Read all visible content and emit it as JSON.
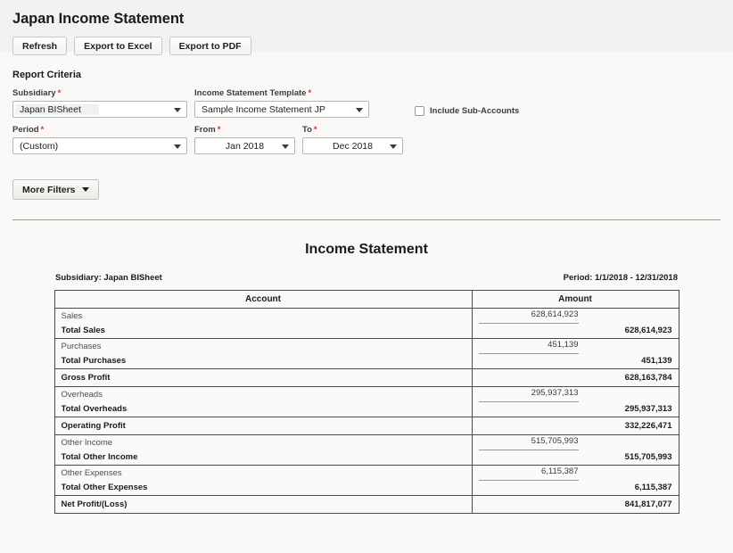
{
  "header": {
    "title": "Japan Income Statement",
    "buttons": [
      {
        "label": "Refresh",
        "name": "refresh-button"
      },
      {
        "label": "Export to Excel",
        "name": "export-excel-button"
      },
      {
        "label": "Export to PDF",
        "name": "export-pdf-button"
      }
    ]
  },
  "criteria": {
    "section_title": "Report Criteria",
    "subsidiary": {
      "label": "Subsidiary",
      "required": "*",
      "value": "Japan BISheet"
    },
    "template": {
      "label": "Income Statement Template",
      "required": "*",
      "value": "Sample Income Statement JP"
    },
    "period": {
      "label": "Period",
      "required": "*",
      "value": "(Custom)"
    },
    "from": {
      "label": "From",
      "required": "*",
      "value": "Jan 2018"
    },
    "to": {
      "label": "To",
      "required": "*",
      "value": "Dec 2018"
    },
    "include_sub_accounts": {
      "label": "Include Sub-Accounts",
      "checked": false
    },
    "more_filters": {
      "label": "More Filters",
      "icon": "chevron-down-icon"
    }
  },
  "report": {
    "title": "Income Statement",
    "subsidiary_line": "Subsidiary: Japan BISheet",
    "period_line": "Period: 1/1/2018 - 12/31/2018",
    "columns": {
      "account": "Account",
      "amount": "Amount"
    },
    "groups": [
      {
        "detail_label": "Sales",
        "detail_amount": "628,614,923",
        "total_label": "Total Sales",
        "total_amount": "628,614,923"
      },
      {
        "detail_label": "Purchases",
        "detail_amount": "451,139",
        "total_label": "Total Purchases",
        "total_amount": "451,139"
      },
      {
        "single_label": "Gross Profit",
        "single_amount": "628,163,784"
      },
      {
        "detail_label": "Overheads",
        "detail_amount": "295,937,313",
        "total_label": "Total Overheads",
        "total_amount": "295,937,313"
      },
      {
        "single_label": "Operating Profit",
        "single_amount": "332,226,471"
      },
      {
        "detail_label": "Other Income",
        "detail_amount": "515,705,993",
        "total_label": "Total Other Income",
        "total_amount": "515,705,993"
      },
      {
        "detail_label": "Other Expenses",
        "detail_amount": "6,115,387",
        "total_label": "Total Other Expenses",
        "total_amount": "6,115,387"
      },
      {
        "single_label": "Net Profit/(Loss)",
        "single_amount": "841,817,077"
      }
    ]
  },
  "colors": {
    "header_band": "#f3f2f0",
    "page_background": "#faf9f7",
    "required_marker": "#d4371c",
    "table_border": "#4a4a4a"
  }
}
